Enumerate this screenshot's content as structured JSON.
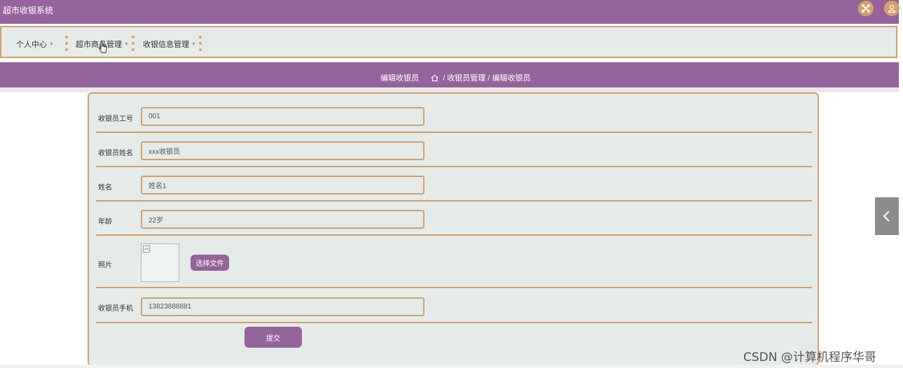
{
  "app": {
    "title": "超市收银系统"
  },
  "nav": {
    "items": [
      {
        "label": "个人中心"
      },
      {
        "label": "超市商品管理"
      },
      {
        "label": "收银信息管理"
      }
    ]
  },
  "breadcrumb": {
    "title": "编辑收银员",
    "path": " / 收银员管理 / 编辑收银员"
  },
  "form": {
    "fields": [
      {
        "label": "收银员工号",
        "value": "001"
      },
      {
        "label": "收银员姓名",
        "value": "xxx收银员"
      },
      {
        "label": "姓名",
        "value": "姓名1"
      },
      {
        "label": "年龄",
        "value": "22岁"
      }
    ],
    "photo": {
      "label": "照片",
      "choose_label": "选择文件"
    },
    "phone": {
      "label": "收银员手机",
      "value": "13823888881"
    },
    "submit_label": "提交"
  },
  "watermark": "CSDN @计算机程序华哥",
  "colors": {
    "primary": "#95649d",
    "accent": "#d5a06c",
    "panel": "#e4ebe8"
  },
  "icons": [
    "fullscreen-icon",
    "user-icon",
    "home-icon",
    "broken-image-icon",
    "chevron-left-icon",
    "cursor-icon"
  ]
}
